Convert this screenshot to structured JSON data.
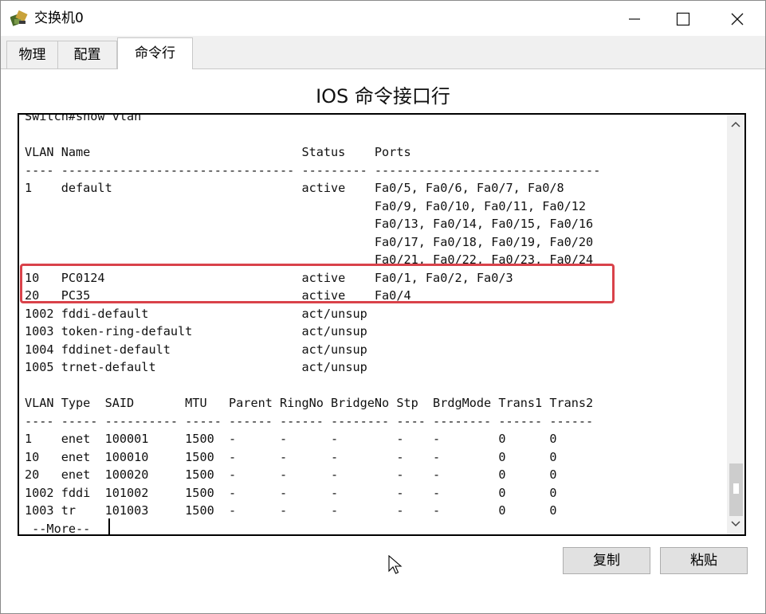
{
  "window": {
    "title": "交换机0"
  },
  "tabs": [
    {
      "label": "物理"
    },
    {
      "label": "配置"
    },
    {
      "label": "命令行",
      "active": true
    }
  ],
  "panel": {
    "title": "IOS 命令接口行"
  },
  "terminal": {
    "lines": [
      "Switch#show vlan",
      "",
      "VLAN Name                             Status    Ports",
      "---- -------------------------------- --------- -------------------------------",
      "1    default                          active    Fa0/5, Fa0/6, Fa0/7, Fa0/8",
      "                                                Fa0/9, Fa0/10, Fa0/11, Fa0/12",
      "                                                Fa0/13, Fa0/14, Fa0/15, Fa0/16",
      "                                                Fa0/17, Fa0/18, Fa0/19, Fa0/20",
      "                                                Fa0/21, Fa0/22, Fa0/23, Fa0/24",
      "10   PC0124                           active    Fa0/1, Fa0/2, Fa0/3",
      "20   PC35                             active    Fa0/4",
      "1002 fddi-default                     act/unsup",
      "1003 token-ring-default               act/unsup",
      "1004 fddinet-default                  act/unsup",
      "1005 trnet-default                    act/unsup",
      "",
      "VLAN Type  SAID       MTU   Parent RingNo BridgeNo Stp  BrdgMode Trans1 Trans2",
      "---- ----- ---------- ----- ------ ------ -------- ---- -------- ------ ------",
      "1    enet  100001     1500  -      -      -        -    -        0      0",
      "10   enet  100010     1500  -      -      -        -    -        0      0",
      "20   enet  100020     1500  -      -      -        -    -        0      0",
      "1002 fddi  101002     1500  -      -      -        -    -        0      0",
      "1003 tr    101003     1500  -      -      -        -    -        0      0",
      " --More-- "
    ]
  },
  "buttons": {
    "copy": "复制",
    "paste": "粘贴"
  },
  "colors": {
    "highlight": "#d9424a",
    "tab_bar": "#f0f0f0"
  }
}
